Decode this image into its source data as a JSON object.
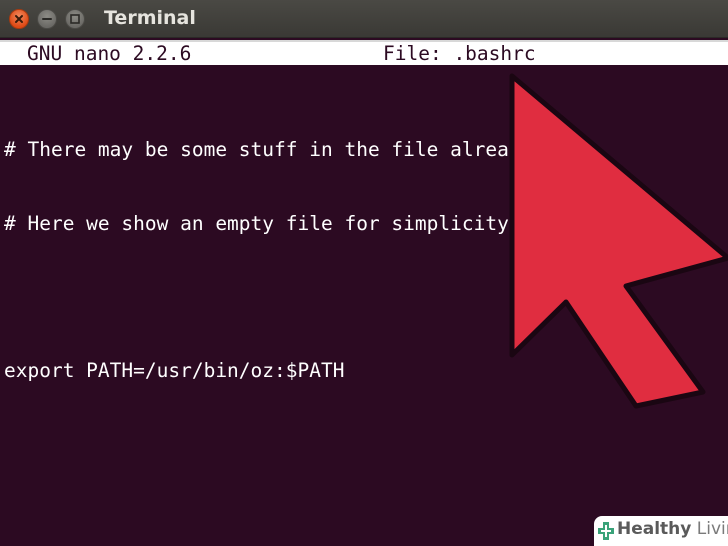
{
  "window": {
    "title": "Terminal",
    "buttons": {
      "close_icon": "close-icon",
      "minimize_icon": "minimize-icon",
      "maximize_icon": "maximize-icon"
    }
  },
  "nano": {
    "version": "GNU nano 2.2.6",
    "file": "File: .bashrc"
  },
  "editor": {
    "lines": [
      "# There may be some stuff in the file already.",
      "# Here we show an empty file for simplicity.",
      "",
      "export PATH=/usr/bin/oz:$PATH"
    ]
  },
  "overlay": {
    "pointer": "mouse-pointer-arrow",
    "pointer_color": "#e02d40",
    "pointer_outline": "#1a0612"
  },
  "watermark": {
    "part_a": "Healthy",
    "part_b": " Living"
  },
  "colors": {
    "terminal_bg": "#2c0a22",
    "titlebar_bg": "#3c3b37",
    "text": "#ffffff"
  }
}
